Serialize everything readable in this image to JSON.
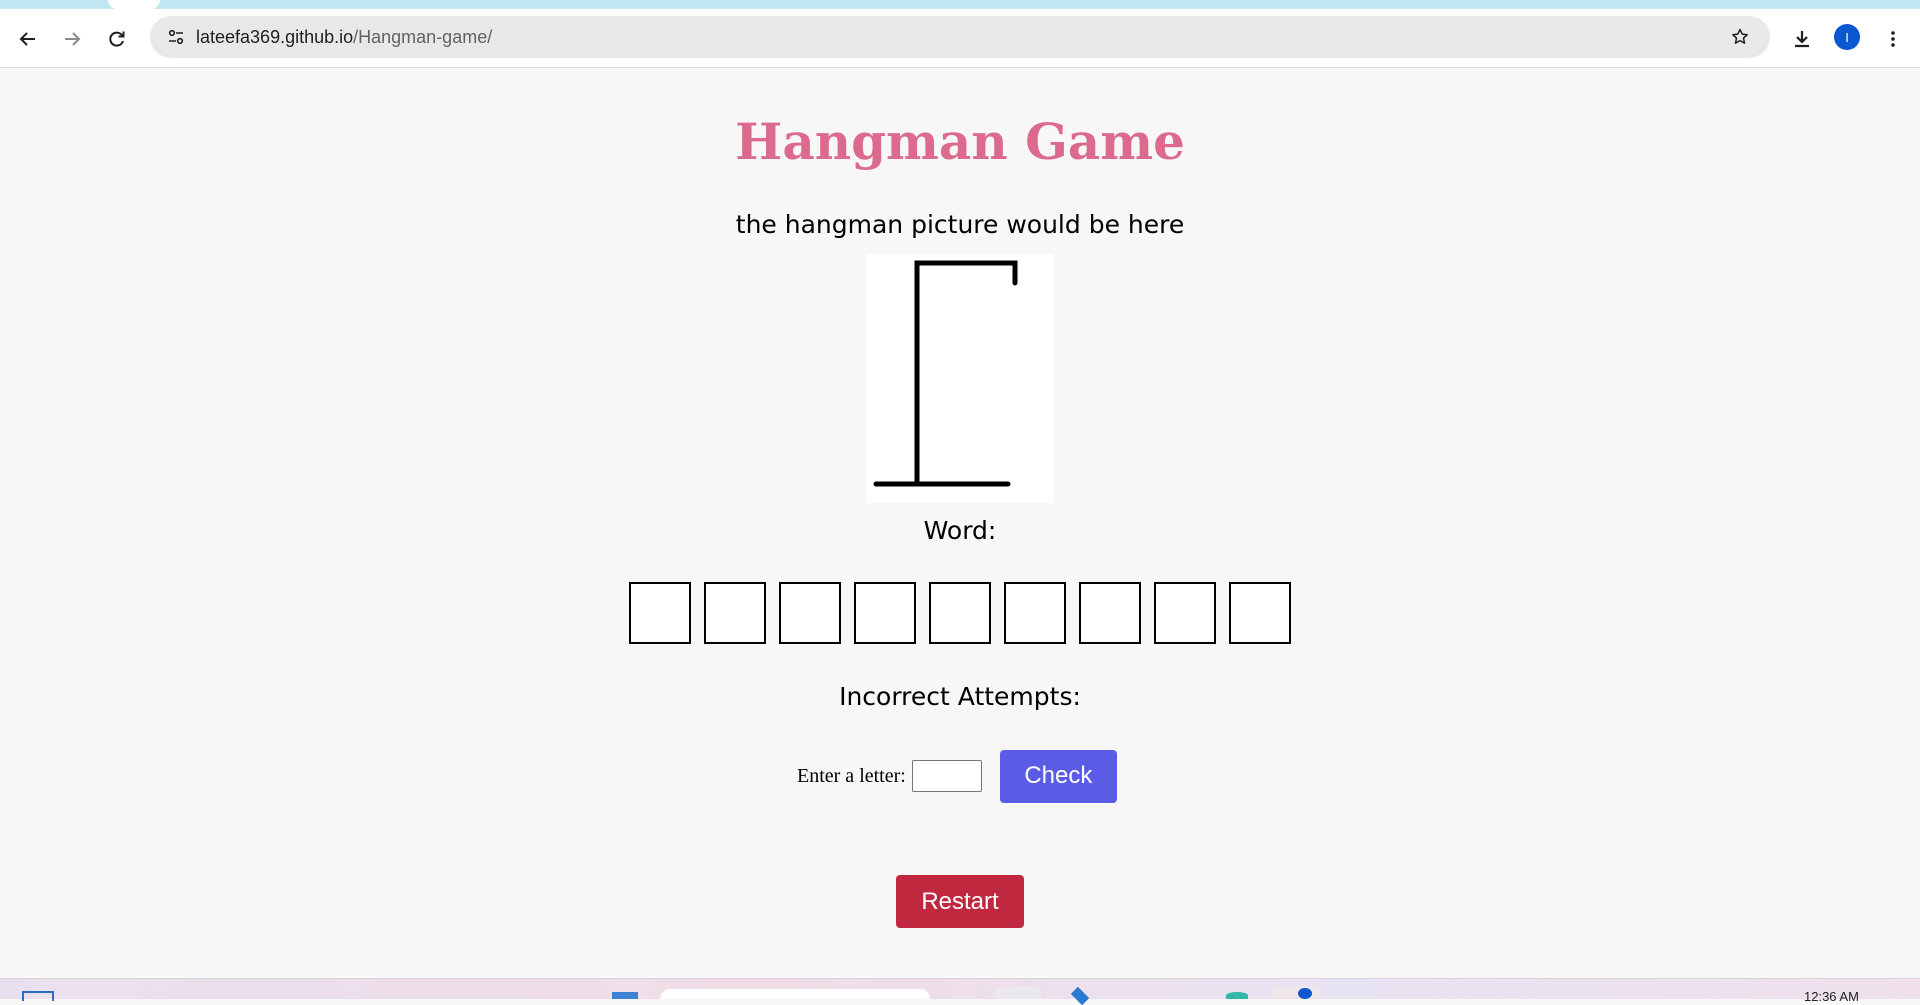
{
  "browser": {
    "url_domain": "lateefa369.github.io",
    "url_path": "/Hangman-game/",
    "profile_initial": "I"
  },
  "page": {
    "title": "Hangman Game",
    "subtitle": "the hangman picture would be here",
    "word_label": "Word:",
    "word_slots": [
      "",
      "",
      "",
      "",
      "",
      "",
      "",
      "",
      ""
    ],
    "attempts_label": "Incorrect Attempts:",
    "letter_label": "Enter a letter:",
    "letter_value": "",
    "check_label": "Check",
    "restart_label": "Restart"
  },
  "taskbar": {
    "clock": "12:36 AM"
  },
  "colors": {
    "title": "#dc6a8d",
    "check_button": "#5b5ce6",
    "restart_button": "#c0283f",
    "page_background": "#f7f7f7"
  },
  "icons": [
    "back-arrow-icon",
    "forward-arrow-icon",
    "reload-icon",
    "site-info-icon",
    "star-icon",
    "download-icon",
    "more-vert-icon"
  ]
}
